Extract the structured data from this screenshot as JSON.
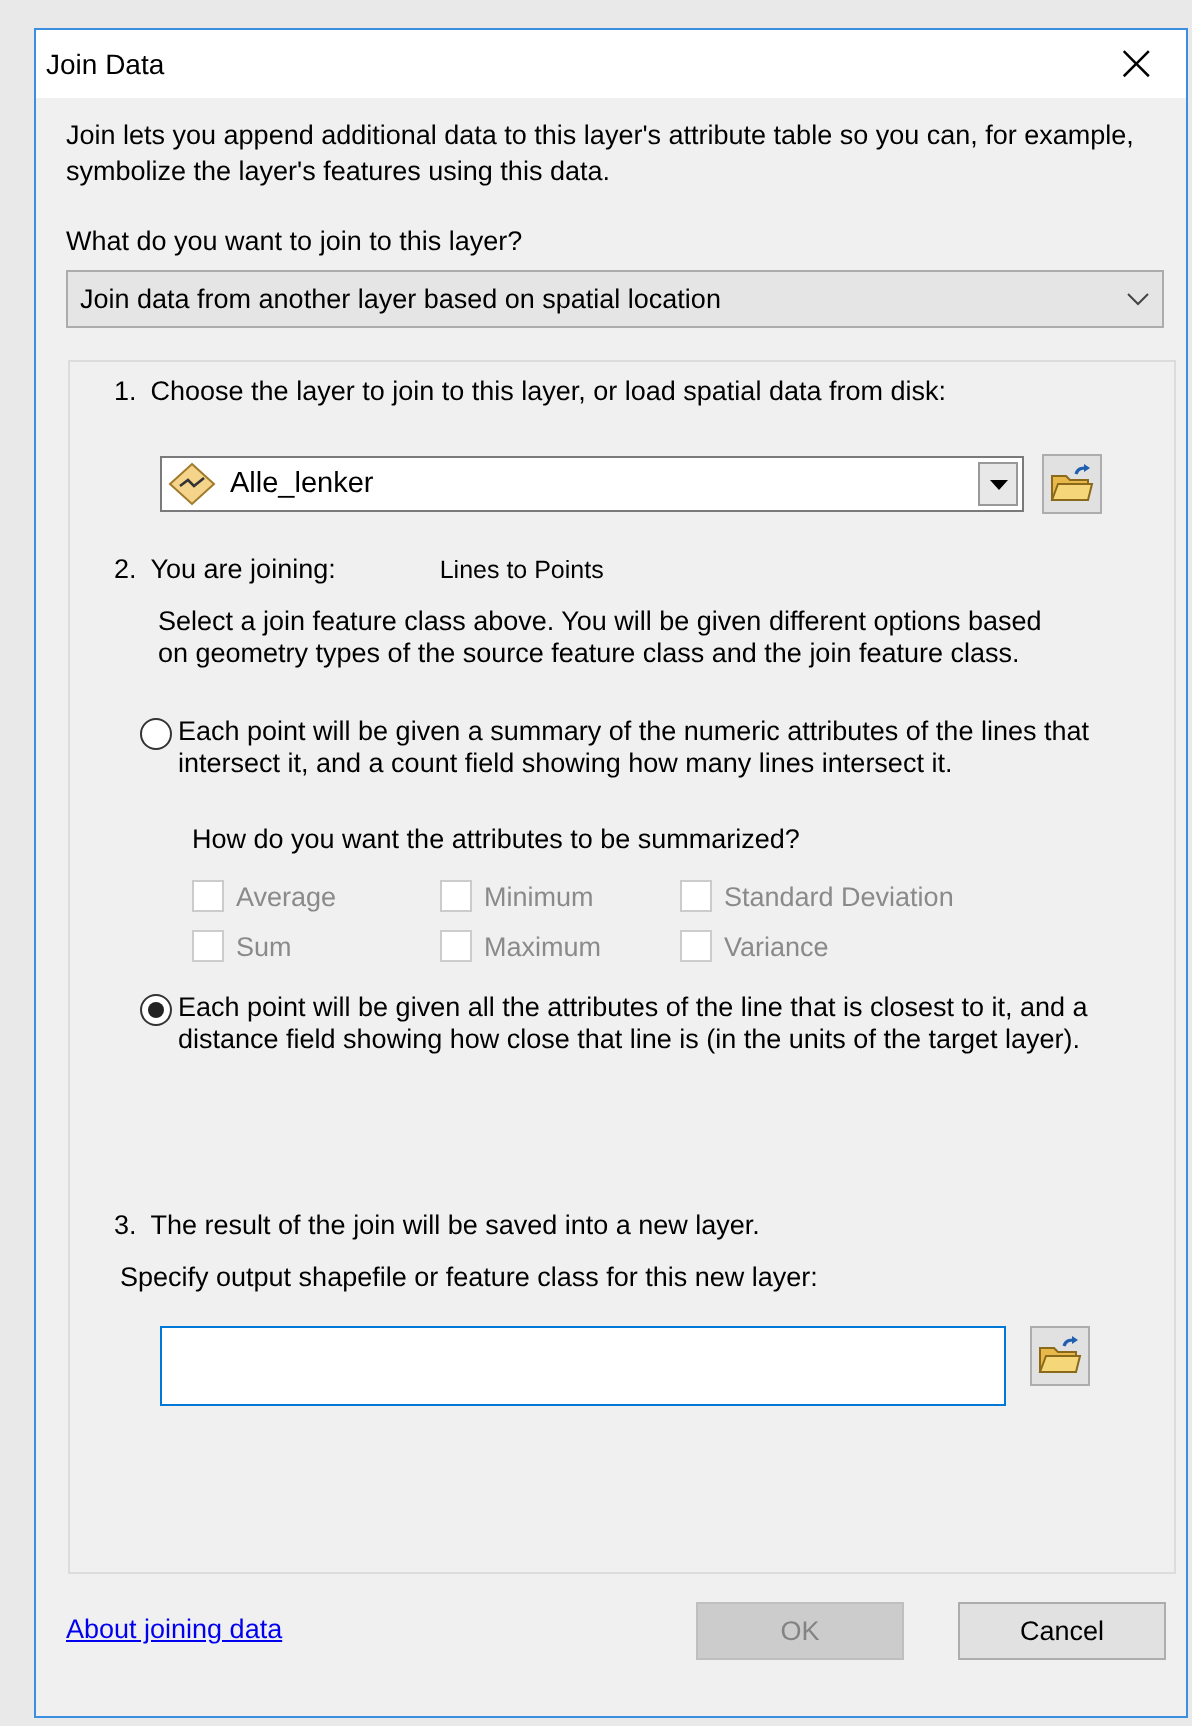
{
  "window": {
    "title": "Join Data",
    "close": "×"
  },
  "intro": "Join lets you append additional data to this layer's attribute table so you can, for example, symbolize the layer's features using this data.",
  "question": "What do you want to join to this layer?",
  "join_type": {
    "value": "Join data from another layer based on spatial location"
  },
  "step1": {
    "number": "1.",
    "label": "Choose the layer to join to this layer, or load spatial data from disk:",
    "layer": "Alle_lenker"
  },
  "step2": {
    "number": "2.",
    "label": "You are joining:",
    "joining": "Lines to Points",
    "description": "Select a join feature class above.  You will be given different options based on geometry types of the source feature class and the join feature class.",
    "options": [
      {
        "text": "Each point will be given a summary of the numeric attributes of the lines that intersect it, and a count field showing how many lines intersect it.",
        "selected": false
      },
      {
        "text": "Each point will be given all the attributes of the line that is closest to it, and a distance field showing how close that line is (in the units of the target layer).",
        "selected": true
      }
    ],
    "summary_question": "How do you want the attributes to be summarized?",
    "summaries": [
      {
        "label": "Average",
        "checked": false,
        "disabled": true
      },
      {
        "label": "Minimum",
        "checked": false,
        "disabled": true
      },
      {
        "label": "Standard Deviation",
        "checked": false,
        "disabled": true
      },
      {
        "label": "Sum",
        "checked": false,
        "disabled": true
      },
      {
        "label": "Maximum",
        "checked": false,
        "disabled": true
      },
      {
        "label": "Variance",
        "checked": false,
        "disabled": true
      }
    ]
  },
  "step3": {
    "number": "3.",
    "label": "The result of the join will be saved into a new layer.",
    "prompt": "Specify output shapefile or feature class for this new layer:"
  },
  "link": "About joining data",
  "buttons": [
    {
      "label": "OK",
      "disabled": true
    },
    {
      "label": "Cancel",
      "disabled": false
    }
  ]
}
